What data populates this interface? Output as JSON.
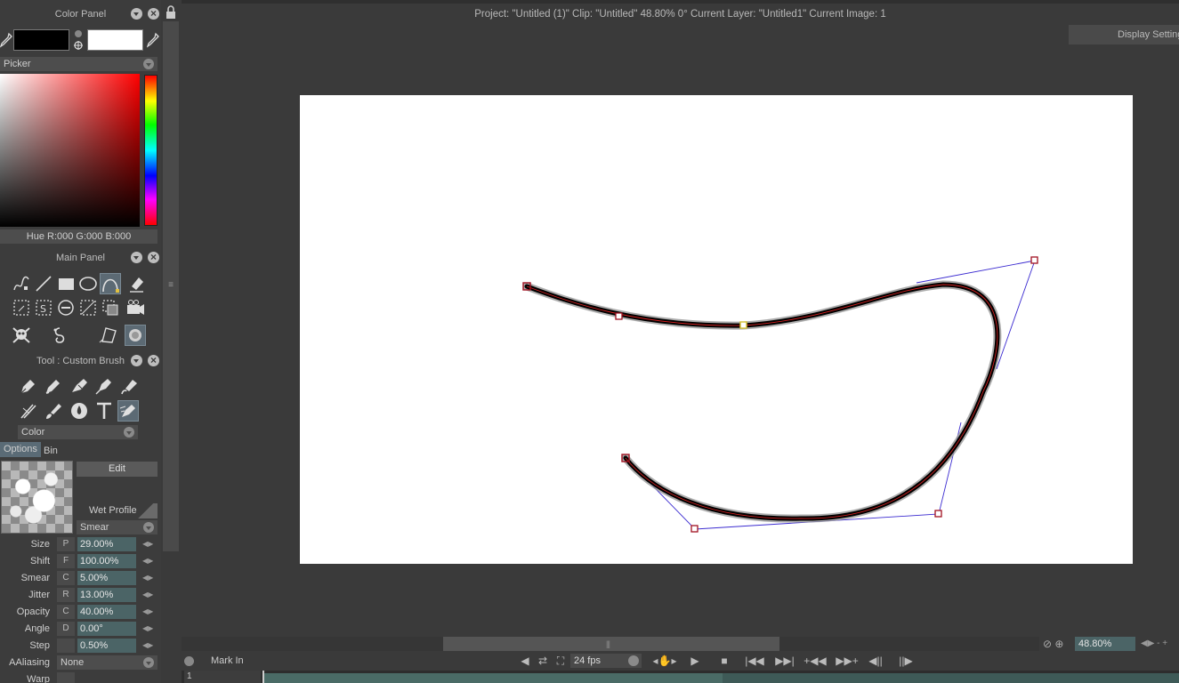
{
  "color_panel": {
    "title": "Color Panel",
    "foreground": "#000000",
    "background": "#ffffff",
    "mode": "Picker",
    "readout": "Hue R:000 G:000 B:000"
  },
  "main_panel": {
    "title": "Main Panel"
  },
  "tool_panel": {
    "title": "Tool : Custom Brush",
    "color_mode": "Color",
    "tabs": [
      "Options",
      "Bin"
    ],
    "edit_label": "Edit",
    "wet_profile_label": "Wet Profile",
    "profile_value": "Smear",
    "params": [
      {
        "label": "Size",
        "mod": "P",
        "value": "29.00%"
      },
      {
        "label": "Shift",
        "mod": "F",
        "value": "100.00%"
      },
      {
        "label": "Smear",
        "mod": "C",
        "value": "5.00%"
      },
      {
        "label": "Jitter",
        "mod": "R",
        "value": "13.00%"
      },
      {
        "label": "Opacity",
        "mod": "C",
        "value": "40.00%"
      },
      {
        "label": "Angle",
        "mod": "D",
        "value": "0.00°"
      },
      {
        "label": "Step",
        "mod": "",
        "value": "0.50%"
      }
    ],
    "aaliasing_label": "AAliasing",
    "aaliasing_value": "None",
    "warp_label": "Warp"
  },
  "canvas": {
    "status": "Project:  \"Untitled (1)\"  Clip: \"Untitled\"   48.80%   0°  Current Layer: \"Untitled1\"  Current Image: 1",
    "display_settings": "Display Settings"
  },
  "bottom": {
    "zoom": "48.80%",
    "mark_in": "Mark In",
    "fps": "24 fps",
    "frame": "1"
  },
  "colors": {
    "accent_field": "#4b6466",
    "stroke": "#000000",
    "control_point": "#a01020",
    "active_point": "#d4c030",
    "handle_line": "#3a2ad0"
  }
}
